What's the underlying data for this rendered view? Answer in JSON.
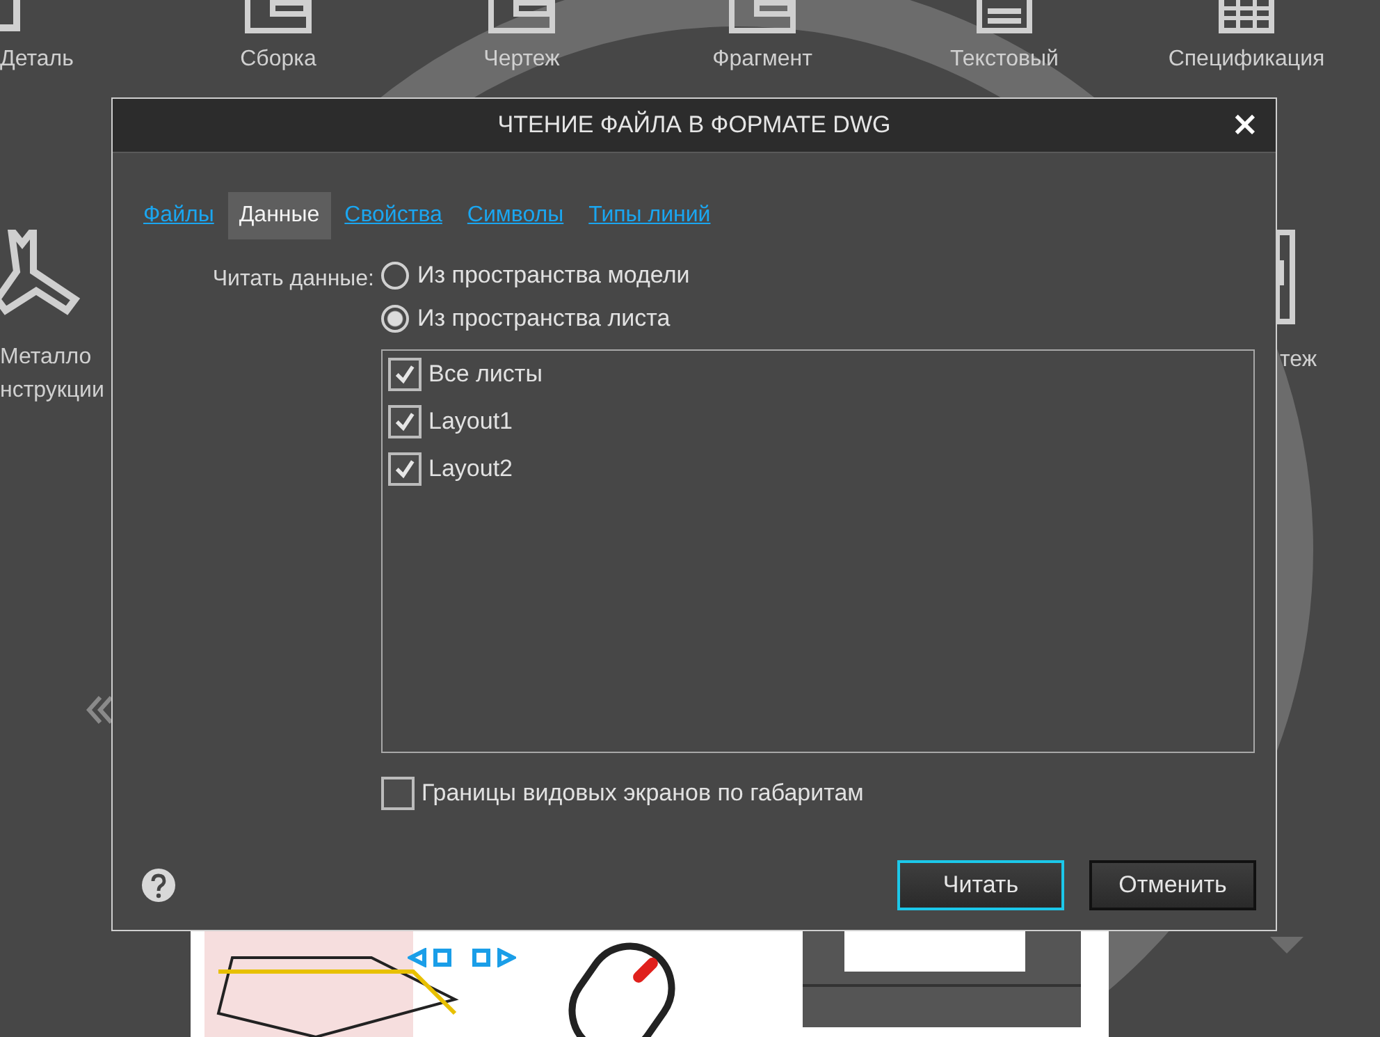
{
  "launcher": {
    "items": [
      {
        "label": "Деталь",
        "kind": "part"
      },
      {
        "label": "Сборка",
        "kind": "assembly"
      },
      {
        "label": "Чертеж",
        "kind": "drawing"
      },
      {
        "label": "Фрагмент",
        "kind": "fragment"
      },
      {
        "label": "Текстовый",
        "kind": "text"
      },
      {
        "label": "Спецификация",
        "kind": "spec"
      }
    ],
    "side_left": {
      "lines": [
        "Металло",
        "нструкции"
      ]
    },
    "side_right": {
      "label": "теж"
    }
  },
  "dialog": {
    "title": "ЧТЕНИЕ ФАЙЛА В ФОРМАТЕ DWG",
    "close": "×",
    "tabs": [
      {
        "label": "Файлы",
        "selected": false
      },
      {
        "label": "Данные",
        "selected": true
      },
      {
        "label": "Свойства",
        "selected": false
      },
      {
        "label": "Символы",
        "selected": false
      },
      {
        "label": "Типы линий",
        "selected": false
      }
    ],
    "read_label": "Читать данные:",
    "options": [
      {
        "label": "Из пространства модели",
        "selected": false
      },
      {
        "label": "Из пространства листа",
        "selected": true
      }
    ],
    "sheets": [
      {
        "label": "Все листы",
        "checked": true
      },
      {
        "label": "Layout1",
        "checked": true
      },
      {
        "label": "Layout2",
        "checked": true
      }
    ],
    "viewport_bounds": {
      "label": "Границы видовых экранов по габаритам",
      "checked": false
    },
    "buttons": [
      {
        "label": "Читать",
        "kind": "primary"
      },
      {
        "label": "Отменить",
        "kind": "secondary"
      }
    ]
  }
}
